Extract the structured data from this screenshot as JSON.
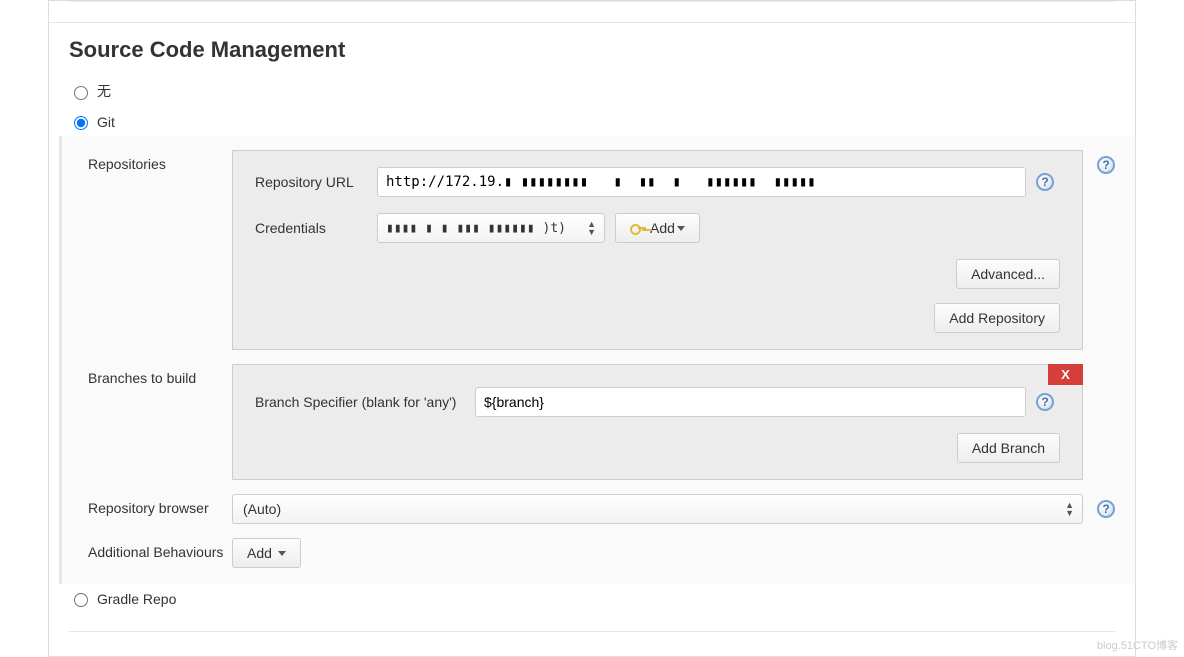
{
  "section_title": "Source Code Management",
  "radios": {
    "none": {
      "label": "无",
      "checked": false
    },
    "git": {
      "label": "Git",
      "checked": true
    },
    "gradle": {
      "label": "Gradle Repo",
      "checked": false
    }
  },
  "repositories": {
    "label": "Repositories",
    "url_label": "Repository URL",
    "url_value": "http://172.19.▮ ▮▮▮▮▮▮▮▮   ▮  ▮▮  ▮   ▮▮▮▮▮▮  ▮▮▮▮▮",
    "credentials_label": "Credentials",
    "credentials_value": "▮▮▮▮ ▮   ▮    ▮▮▮ ▮▮▮▮▮▮ )t)",
    "add_cred_label": "Add",
    "advanced_label": "Advanced...",
    "add_repo_label": "Add Repository"
  },
  "branches": {
    "label": "Branches to build",
    "specifier_label": "Branch Specifier (blank for 'any')",
    "specifier_value": "${branch}",
    "add_branch_label": "Add Branch",
    "close_label": "X"
  },
  "repo_browser": {
    "label": "Repository browser",
    "value": "(Auto)"
  },
  "behaviours": {
    "label": "Additional Behaviours",
    "add_label": "Add"
  },
  "help_glyph": "?",
  "watermark": "blog.51CTO博客"
}
